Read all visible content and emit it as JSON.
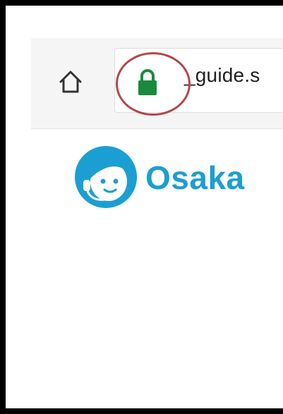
{
  "browser": {
    "home_icon": "home-icon",
    "lock_icon": "lock-icon",
    "url_text": "_guide.s",
    "highlight_color": "#b5464a",
    "lock_color": "#1a8a3c"
  },
  "site": {
    "logo_text": "Osaka",
    "brand_color": "#1b9fd2",
    "logo_icon": "support-agent-mascot-icon"
  }
}
